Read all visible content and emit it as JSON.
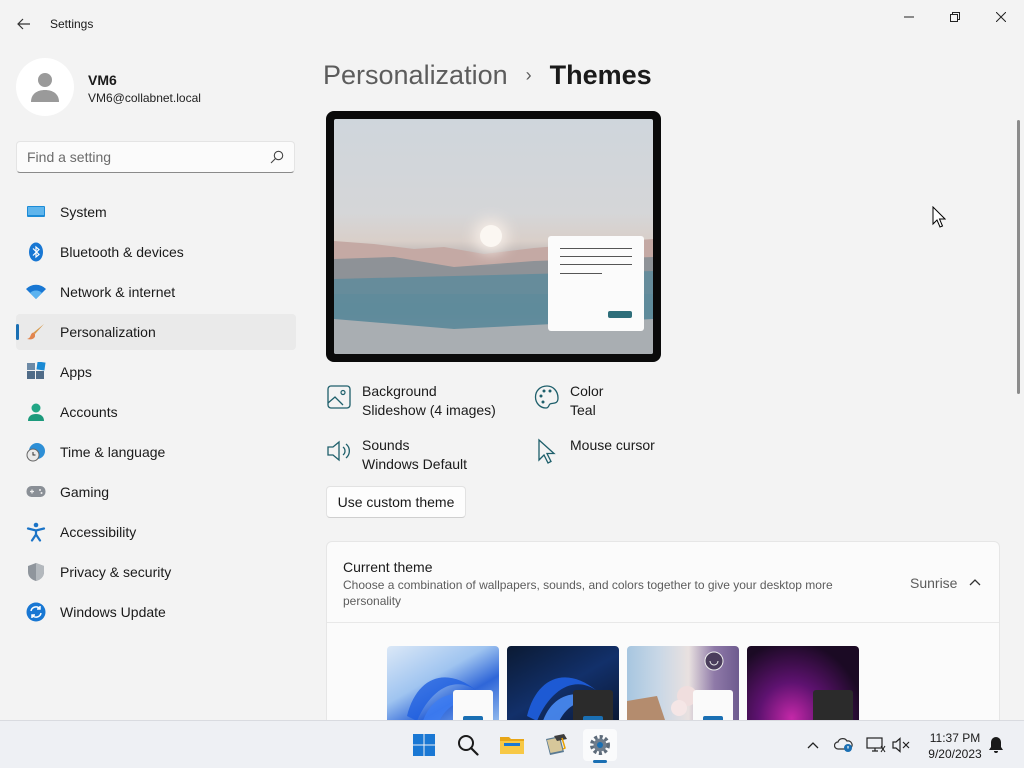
{
  "window": {
    "title": "Settings"
  },
  "user": {
    "name": "VM6",
    "email": "VM6@collabnet.local"
  },
  "search": {
    "placeholder": "Find a setting"
  },
  "nav": {
    "items": [
      {
        "label": "System",
        "icon": "system-icon"
      },
      {
        "label": "Bluetooth & devices",
        "icon": "bluetooth-icon"
      },
      {
        "label": "Network & internet",
        "icon": "wifi-icon"
      },
      {
        "label": "Personalization",
        "icon": "paintbrush-icon",
        "active": true
      },
      {
        "label": "Apps",
        "icon": "apps-icon"
      },
      {
        "label": "Accounts",
        "icon": "accounts-icon"
      },
      {
        "label": "Time & language",
        "icon": "time-language-icon"
      },
      {
        "label": "Gaming",
        "icon": "gamepad-icon"
      },
      {
        "label": "Accessibility",
        "icon": "accessibility-icon"
      },
      {
        "label": "Privacy & security",
        "icon": "shield-icon"
      },
      {
        "label": "Windows Update",
        "icon": "windows-update-icon"
      }
    ]
  },
  "breadcrumb": {
    "parent": "Personalization",
    "separator": "›",
    "current": "Themes"
  },
  "theme_props": {
    "background": {
      "label": "Background",
      "value": "Slideshow (4 images)"
    },
    "color": {
      "label": "Color",
      "value": "Teal"
    },
    "sounds": {
      "label": "Sounds",
      "value": "Windows Default"
    },
    "cursor": {
      "label": "Mouse cursor"
    }
  },
  "actions": {
    "custom_theme_label": "Use custom theme"
  },
  "current_theme": {
    "title": "Current theme",
    "description": "Choose a combination of wallpapers, sounds, and colors together to give your desktop more personality",
    "value": "Sunrise",
    "themes": [
      "windows-light",
      "windows-dark",
      "spotlight",
      "glow"
    ]
  },
  "taskbar": {
    "apps": [
      "start-icon",
      "search-icon",
      "file-explorer-icon",
      "notepad-icon",
      "settings-icon"
    ],
    "active_app": "settings-icon",
    "time": "11:37 PM",
    "date": "9/20/2023"
  },
  "colors": {
    "accent": "#1a6fb3",
    "theme_color": "#2e6e7a"
  }
}
